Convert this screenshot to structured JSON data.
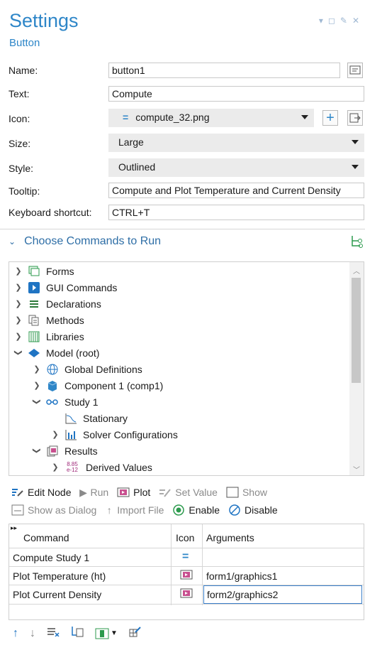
{
  "header": {
    "title": "Settings",
    "subtitle": "Button"
  },
  "form": {
    "name_label": "Name:",
    "name_value": "button1",
    "text_label": "Text:",
    "text_value": "Compute",
    "icon_label": "Icon:",
    "icon_value": "compute_32.png",
    "size_label": "Size:",
    "size_value": "Large",
    "style_label": "Style:",
    "style_value": "Outlined",
    "tooltip_label": "Tooltip:",
    "tooltip_value": "Compute and Plot Temperature and Current Density",
    "shortcut_label": "Keyboard shortcut:",
    "shortcut_value": "CTRL+T"
  },
  "section": {
    "title": "Choose Commands to Run"
  },
  "tree": [
    {
      "label": "Forms",
      "icon": "forms-icon"
    },
    {
      "label": "GUI Commands",
      "icon": "gui-commands-icon"
    },
    {
      "label": "Declarations",
      "icon": "declarations-icon"
    },
    {
      "label": "Methods",
      "icon": "methods-icon"
    },
    {
      "label": "Libraries",
      "icon": "libraries-icon"
    },
    {
      "label": "Model (root)",
      "icon": "model-root-icon"
    },
    {
      "label": "Global Definitions",
      "icon": "globe-icon"
    },
    {
      "label": "Component 1 (comp1)",
      "icon": "component-icon"
    },
    {
      "label": "Study 1",
      "icon": "study-icon"
    },
    {
      "label": "Stationary",
      "icon": "stationary-icon"
    },
    {
      "label": "Solver Configurations",
      "icon": "solver-icon"
    },
    {
      "label": "Results",
      "icon": "results-icon"
    },
    {
      "label": "Derived Values",
      "icon": "derived-values-icon",
      "icon_text_top": "8.85",
      "icon_text_bottom": "e-12"
    }
  ],
  "toolbar1": {
    "edit_node": "Edit Node",
    "run": "Run",
    "plot": "Plot",
    "set_value": "Set Value",
    "show": "Show"
  },
  "toolbar2": {
    "show_as_dialog": "Show as Dialog",
    "import_file": "Import File",
    "enable": "Enable",
    "disable": "Disable"
  },
  "table": {
    "headers": {
      "command": "Command",
      "icon": "Icon",
      "arguments": "Arguments"
    },
    "rows": [
      {
        "command": "Compute Study 1",
        "icon": "compute-icon",
        "arguments": ""
      },
      {
        "command": "Plot Temperature (ht)",
        "icon": "plot-icon",
        "arguments": "form1/graphics1"
      },
      {
        "command": "Plot Current Density",
        "icon": "plot-icon",
        "arguments": "form2/graphics2"
      }
    ]
  },
  "colors": {
    "accent": "#2e86c8",
    "section": "#2e6ea6",
    "dropdown_bg": "#ebebeb"
  }
}
